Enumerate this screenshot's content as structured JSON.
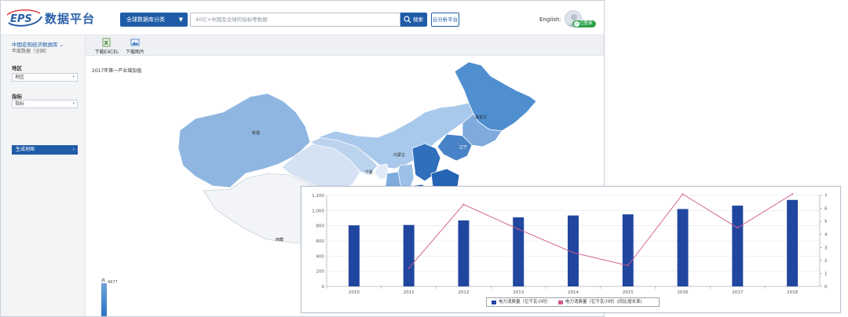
{
  "header": {
    "logo_text": "数据平台",
    "logo_mark": "EPS",
    "category_button": "全球数据库分类",
    "search_placeholder": "40亿+中国及全球的指标等数据",
    "search_button": "搜索",
    "analysis_button": "云分析平台",
    "language": "English",
    "separator": "|",
    "login_label": "已登录"
  },
  "sidebar": {
    "database_title": "中国宏观经济数据库",
    "database_sub": "年度数据（全国）",
    "region_label": "地区",
    "region_value": "地区",
    "indicator_label": "指标",
    "indicator_value": "指标",
    "generate_button": "生成地图"
  },
  "toolbar": {
    "excel_label": "下载EXCEL",
    "image_label": "下载图片"
  },
  "map": {
    "title": "2017年第一产业增加值",
    "legend_high": "高",
    "legend_max": "4877",
    "provinces": [
      "新疆",
      "西藏",
      "内蒙古",
      "黑龙江",
      "辽宁",
      "宁夏"
    ]
  },
  "chart_data": {
    "type": "bar",
    "categories": [
      "2010",
      "2011",
      "2012",
      "2013",
      "2014",
      "2015",
      "2016",
      "2017",
      "2018"
    ],
    "series": [
      {
        "name": "电力消费量（亿千瓦小时）",
        "type": "bar",
        "axis": "left",
        "color": "#2146a0",
        "values": [
          805,
          810,
          870,
          910,
          935,
          950,
          1020,
          1065,
          1140
        ]
      },
      {
        "name": "电力消费量（亿千瓦小时）(同比增长率)",
        "type": "line",
        "axis": "right",
        "color": "#d05a8c",
        "values": [
          null,
          1.4,
          6.3,
          4.4,
          2.6,
          1.6,
          7.1,
          4.5,
          7.1
        ]
      }
    ],
    "y_left": {
      "min": 0,
      "max": 1200,
      "ticks": [
        "0",
        "200",
        "400",
        "600",
        "800",
        "1,000",
        "1,200"
      ]
    },
    "y_right": {
      "min": 0,
      "max": 7,
      "ticks": [
        "0",
        "1",
        "2",
        "3",
        "4",
        "5",
        "6",
        "7"
      ]
    },
    "legend_position": "bottom-center",
    "grid": true
  }
}
